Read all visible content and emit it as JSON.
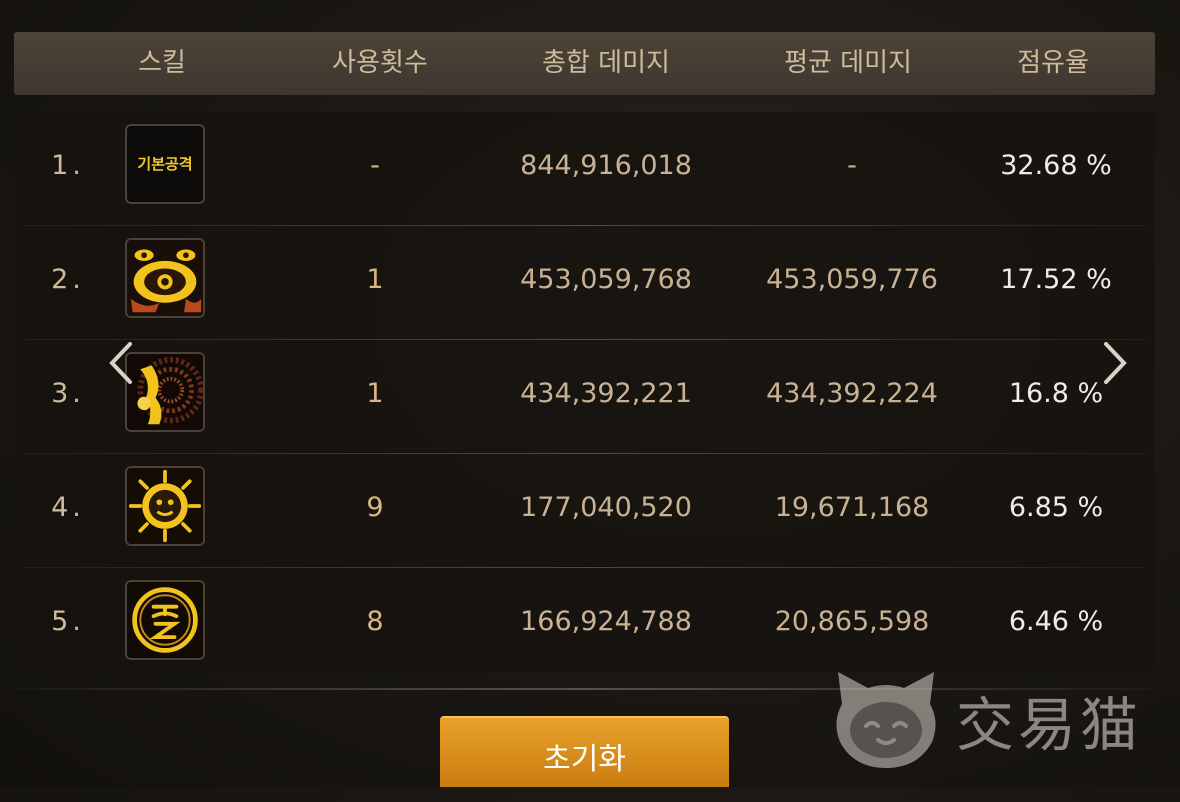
{
  "header": {
    "skill": "스킬",
    "uses": "사용횟수",
    "total_damage": "총합 데미지",
    "avg_damage": "평균 데미지",
    "share": "점유율"
  },
  "rows": [
    {
      "rank": "1.",
      "icon": "basic-attack-icon",
      "icon_text": "기본공격",
      "uses": "-",
      "total": "844,916,018",
      "avg": "-",
      "share": "32.68 %"
    },
    {
      "rank": "2.",
      "icon": "eye-skill-icon",
      "uses": "1",
      "total": "453,059,768",
      "avg": "453,059,776",
      "share": "17.52 %"
    },
    {
      "rank": "3.",
      "icon": "vortex-skill-icon",
      "uses": "1",
      "total": "434,392,221",
      "avg": "434,392,224",
      "share": "16.8 %"
    },
    {
      "rank": "4.",
      "icon": "sun-face-skill-icon",
      "uses": "9",
      "total": "177,040,520",
      "avg": "19,671,168",
      "share": "6.85 %"
    },
    {
      "rank": "5.",
      "icon": "rune-circle-skill-icon",
      "uses": "8",
      "total": "166,924,788",
      "avg": "20,865,598",
      "share": "6.46 %"
    }
  ],
  "reset_button": "초기화",
  "nav": {
    "prev_icon": "chevron-left-icon",
    "next_icon": "chevron-right-icon"
  },
  "watermark": {
    "text": "交易猫",
    "icon": "cat-logo-icon"
  },
  "colors": {
    "accent": "#d9a233",
    "header_bg": "#463e33",
    "text_light": "#f0ebe3",
    "text_muted": "#c9b294"
  }
}
